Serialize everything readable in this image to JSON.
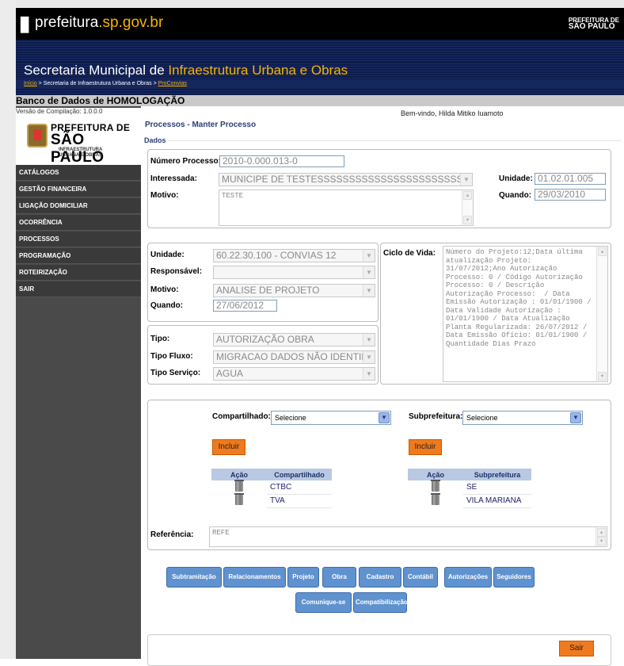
{
  "banner": {
    "logo_main": "prefeitura",
    "logo_domain": ".sp.gov.br",
    "badge_top": "PREFEITURA DE",
    "badge_bottom": "SÃO PAULO"
  },
  "secretaria": {
    "prefix": "Secretaria Municipal de ",
    "highlight": "Infraestrutura Urbana e Obras"
  },
  "breadcrumb": {
    "home": "Início",
    "sep1": " > ",
    "secretaria": "Secretaria de Infraestrutura Urbana e Obras",
    "sep2": " > ",
    "app": "ProConvias"
  },
  "db_title": "Banco de Dados de HOMOLOGAÇÃO",
  "sidebar": {
    "version": "Versão de Compilação: 1.0.0.0",
    "logo": {
      "line1": "PREFEITURA DE",
      "line2": "SÃO PAULO",
      "line3": "INFRAESTRUTURA",
      "line4": "URBANA E OBRAS"
    },
    "items": [
      "CATÁLOGOS",
      "GESTÃO FINANCEIRA",
      "LIGAÇÃO DOMICILIAR",
      "OCORRÊNCIA",
      "PROCESSOS",
      "PROGRAMAÇÃO",
      "ROTEIRIZAÇÃO",
      "SAIR"
    ]
  },
  "welcome": "Bem-vindo, Hilda Mitiko Iuamoto",
  "page_title": "Processos - Manter Processo",
  "dados": {
    "legend": "Dados",
    "numero_label": "Número Processo:",
    "numero_value": "2010-0.000.013-0",
    "interessada_label": "Interessada:",
    "interessada_value": "MUNICIPE DE TESTESSSSSSSSSSSSSSSSSSSSSSSSSSSS",
    "unidade_label": "Unidade:",
    "unidade_value": "01.02.01.005",
    "motivo_label": "Motivo:",
    "motivo_value": "TESTE",
    "quando_label": "Quando:",
    "quando_value": "29/03/2010"
  },
  "tramite": {
    "unidade_label": "Unidade:",
    "unidade_value": "60.22.30.100 - CONVIAS 12",
    "responsavel_label": "Responsável:",
    "responsavel_value": "",
    "motivo_label": "Motivo:",
    "motivo_value": "ANALISE DE PROJETO",
    "quando_label": "Quando:",
    "quando_value": "27/06/2012",
    "ciclo_label": "Ciclo de Vida:",
    "ciclo_value": "Número do Projeto:12;Data última atualização Projeto: 31/07/2012;Ano Autorização Processo: 0 / Código Autorização Processo: 0 / Descrição Autorização Processo:  / Data Emissão Autorização : 01/01/1900 / Data Validade Autorização : 01/01/1900 / Data Atualização Planta Regularizada: 26/07/2012 / Data Emissão Ofício: 01/01/1900 / Quantidade Dias Prazo"
  },
  "tipo": {
    "tipo_label": "Tipo:",
    "tipo_value": "AUTORIZAÇÃO OBRA",
    "fluxo_label": "Tipo Fluxo:",
    "fluxo_value": "MIGRACAO DADOS NÃO IDENTIFICADO",
    "servico_label": "Tipo Serviço:",
    "servico_value": "AGUA"
  },
  "compart": {
    "label": "Compartilhado:",
    "select_value": "Selecione",
    "incluir": "Incluir",
    "col_acao": "Ação",
    "col_nome": "Compartilhado",
    "rows": [
      "CTBC",
      "TVA"
    ]
  },
  "subpref": {
    "label": "Subprefeitura:",
    "select_value": "Selecione",
    "incluir": "Incluir",
    "col_acao": "Ação",
    "col_nome": "Subprefeitura",
    "rows": [
      "SE",
      "VILA MARIANA"
    ]
  },
  "referencia": {
    "label": "Referência:",
    "value": "REFE"
  },
  "actions": [
    "Subtramitação",
    "Relacionamentos",
    "Projeto",
    "Obra",
    "Cadastro",
    "Contábil",
    "Autorizações",
    "Seguidores",
    "Comunique-se",
    "Compatibilização"
  ],
  "sair": "Sair"
}
